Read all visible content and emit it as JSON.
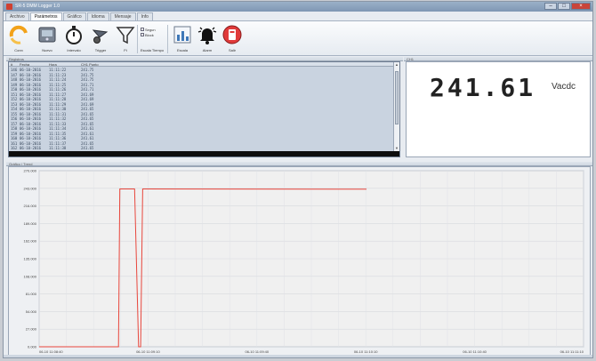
{
  "window": {
    "title": "SR-5 DMM Logger 1.0",
    "minimize": "–",
    "maximize": "□",
    "close": "×"
  },
  "tabs": [
    "Archivo",
    "Parámetros",
    "Gráfico",
    "Idioma",
    "Mensaje",
    "Info"
  ],
  "ribbon": {
    "buttons": [
      {
        "label": "Conn",
        "icon": "connect-icon"
      },
      {
        "label": "Nuevo",
        "icon": "meter-icon"
      },
      {
        "label": "Intervalo",
        "icon": "stopwatch-icon"
      },
      {
        "label": "Trigger",
        "icon": "trigger-icon"
      },
      {
        "label": "Ft",
        "icon": "filter-icon"
      },
      {
        "label": "Escala Tiempo",
        "icon": "timescale-icon"
      },
      {
        "label": "Escala",
        "icon": "chart-icon"
      },
      {
        "label": "Alarm",
        "icon": "bell-icon"
      },
      {
        "label": "Salir",
        "icon": "exit-icon"
      }
    ],
    "scale_options": [
      "Segun",
      "Block"
    ]
  },
  "log": {
    "panel_title": "Registros",
    "headers": [
      "#",
      "Fecha",
      "Hora",
      "CH1 Punto"
    ],
    "rows": [
      [
        "146",
        "06-10-2016",
        "11:11:22",
        "241.75"
      ],
      [
        "147",
        "06-10-2016",
        "11:11:23",
        "241.75"
      ],
      [
        "148",
        "06-10-2016",
        "11:11:24",
        "241.75"
      ],
      [
        "149",
        "06-10-2016",
        "11:11:25",
        "241.71"
      ],
      [
        "150",
        "06-10-2016",
        "11:11:26",
        "241.71"
      ],
      [
        "151",
        "06-10-2016",
        "11:11:27",
        "241.69"
      ],
      [
        "152",
        "06-10-2016",
        "11:11:28",
        "241.69"
      ],
      [
        "153",
        "06-10-2016",
        "11:11:29",
        "241.69"
      ],
      [
        "154",
        "06-10-2016",
        "11:11:30",
        "241.65"
      ],
      [
        "155",
        "06-10-2016",
        "11:11:31",
        "241.65"
      ],
      [
        "156",
        "06-10-2016",
        "11:11:32",
        "241.65"
      ],
      [
        "157",
        "06-10-2016",
        "11:11:33",
        "241.65"
      ],
      [
        "158",
        "06-10-2016",
        "11:11:34",
        "241.61"
      ],
      [
        "159",
        "06-10-2016",
        "11:11:35",
        "241.61"
      ],
      [
        "160",
        "06-10-2016",
        "11:11:36",
        "241.61"
      ],
      [
        "161",
        "06-10-2016",
        "11:11:37",
        "241.65"
      ],
      [
        "162",
        "06-10-2016",
        "11:11:38",
        "241.65"
      ],
      [
        "163",
        "06-10-2016",
        "11:11:39",
        "241.61"
      ],
      [
        "164",
        "06-10-2016",
        "11:11:40",
        "241.61"
      ]
    ]
  },
  "readout": {
    "panel_title": "CH1",
    "value": "241.61",
    "unit": "Vacdc"
  },
  "chart": {
    "panel_title": "Gráfico / Trend",
    "line_color": "#e8463c"
  },
  "chart_data": {
    "type": "line",
    "ylim": [
      0,
      270
    ],
    "yticks": [
      "270.000",
      "243.000",
      "216.000",
      "189.000",
      "162.000",
      "135.000",
      "108.000",
      "81.000",
      "54.000",
      "27.000",
      "0.000"
    ],
    "xticks": [
      "06-10 11:08:40",
      "06-10 11:09:10",
      "06-10 11:09:40",
      "06-10 11:10:10",
      "06-10 11:10:40",
      "06-10 11:11:10"
    ],
    "series": [
      {
        "t": [
          0,
          1.18,
          1.2,
          1.42,
          1.48,
          1.51,
          1.54,
          1.56,
          4.87
        ],
        "values": [
          0,
          0,
          242,
          242,
          0,
          0,
          242,
          242,
          241.61
        ]
      }
    ],
    "xlim": [
      0,
      8.1
    ]
  }
}
